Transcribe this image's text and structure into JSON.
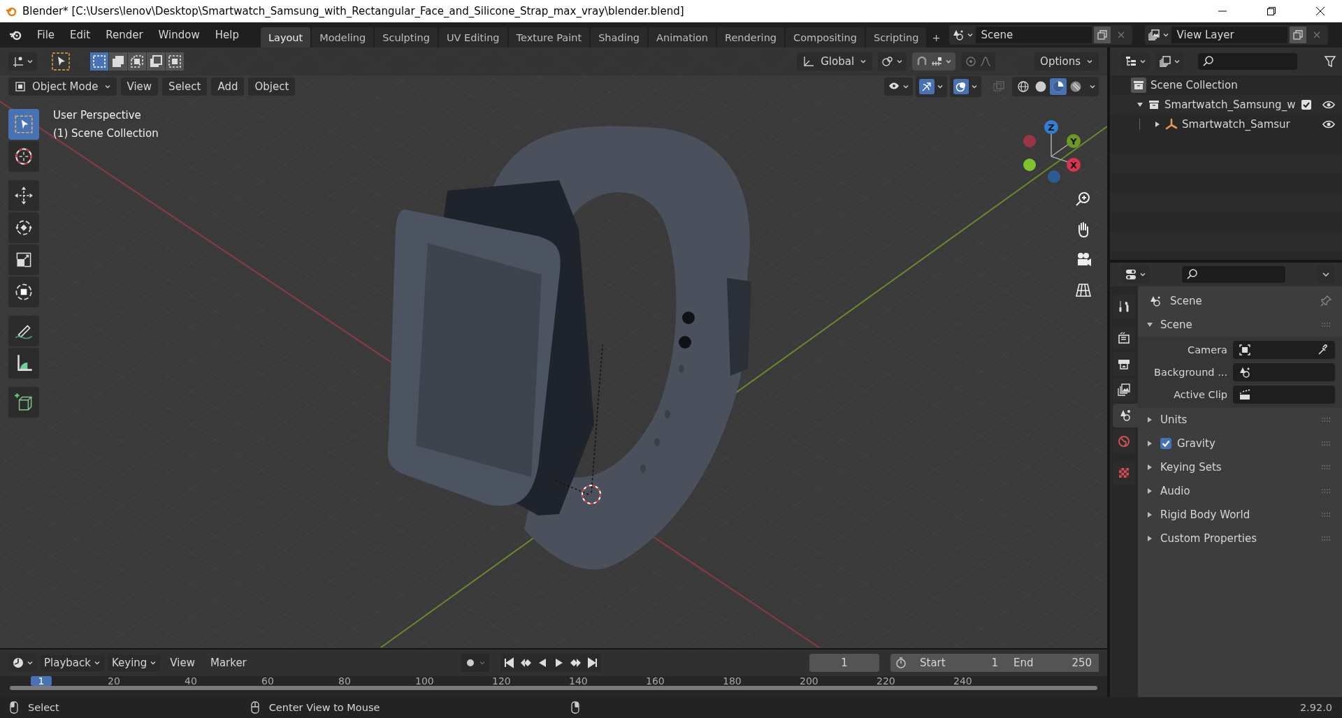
{
  "window": {
    "title": "Blender* [C:\\Users\\lenov\\Desktop\\Smartwatch_Samsung_with_Rectangular_Face_and_Silicone_Strap_max_vray\\blender.blend]"
  },
  "menu": [
    "File",
    "Edit",
    "Render",
    "Window",
    "Help"
  ],
  "workspaces": [
    {
      "label": "Layout",
      "selected": true
    },
    {
      "label": "Modeling",
      "selected": false
    },
    {
      "label": "Sculpting",
      "selected": false
    },
    {
      "label": "UV Editing",
      "selected": false
    },
    {
      "label": "Texture Paint",
      "selected": false
    },
    {
      "label": "Shading",
      "selected": false
    },
    {
      "label": "Animation",
      "selected": false
    },
    {
      "label": "Rendering",
      "selected": false
    },
    {
      "label": "Compositing",
      "selected": false
    },
    {
      "label": "Scripting",
      "selected": false
    }
  ],
  "add_workspace": "+",
  "scene": {
    "name": "Scene"
  },
  "view_layer": {
    "name": "View Layer"
  },
  "tool_header": {
    "orientation": "Global",
    "options": "Options"
  },
  "viewport_header": {
    "mode": "Object Mode",
    "menus": [
      "View",
      "Select",
      "Add",
      "Object"
    ]
  },
  "shading": [
    {
      "kind": "wireframe",
      "selected": false
    },
    {
      "kind": "solid",
      "selected": false
    },
    {
      "kind": "material",
      "selected": true
    },
    {
      "kind": "rendered",
      "selected": false
    }
  ],
  "viewport": {
    "overlay_lines": [
      "User Perspective",
      "(1) Scene Collection"
    ],
    "gizmo_axes": [
      {
        "label": "Z",
        "color": "#2f7fd8"
      },
      {
        "label": "Y",
        "color": "#6b9a23"
      },
      {
        "label": "X",
        "color": "#d8344f"
      }
    ]
  },
  "tools": [
    {
      "kind": "select",
      "selected": true
    },
    {
      "kind": "cursor",
      "selected": false
    },
    {
      "kind": "move",
      "selected": false
    },
    {
      "kind": "rotate",
      "selected": false
    },
    {
      "kind": "scale",
      "selected": false
    },
    {
      "kind": "transform",
      "selected": false
    },
    {
      "kind": "annotate",
      "selected": false
    },
    {
      "kind": "measure",
      "selected": false
    },
    {
      "kind": "add_cube",
      "selected": false
    }
  ],
  "outliner": {
    "root": "Scene Collection",
    "items": [
      {
        "label": "Smartwatch_Samsung_w",
        "expanded": true,
        "checked": true,
        "children": [
          {
            "label": "Smartwatch_Samsur",
            "expanded": false
          }
        ]
      }
    ]
  },
  "properties": {
    "tabs": [
      {
        "kind": "tool",
        "selected": false
      },
      {
        "kind": "render",
        "selected": false
      },
      {
        "kind": "output",
        "selected": false
      },
      {
        "kind": "view_layer",
        "selected": false
      },
      {
        "kind": "scene",
        "selected": true
      },
      {
        "kind": "world",
        "selected": false
      },
      {
        "kind": "texture",
        "selected": false
      }
    ],
    "title": "Scene",
    "panels": [
      {
        "label": "Scene",
        "expanded": true,
        "fields": [
          {
            "label": "Camera",
            "kind": "camera"
          },
          {
            "label": "Background ...",
            "kind": "scene"
          },
          {
            "label": "Active Clip",
            "kind": "clip"
          }
        ]
      },
      {
        "label": "Units",
        "expanded": false
      },
      {
        "label": "Gravity",
        "expanded": false,
        "checked": true
      },
      {
        "label": "Keying Sets",
        "expanded": false
      },
      {
        "label": "Audio",
        "expanded": false
      },
      {
        "label": "Rigid Body World",
        "expanded": false
      },
      {
        "label": "Custom Properties",
        "expanded": false
      }
    ]
  },
  "timeline": {
    "menus": [
      "Playback",
      "Keying",
      "View",
      "Marker"
    ],
    "current_frame": "1",
    "start_label": "Start",
    "start": "1",
    "end_label": "End",
    "end": "250",
    "ruler": [
      {
        "label": "1",
        "selected": true
      },
      {
        "label": "20",
        "selected": false
      },
      {
        "label": "40",
        "selected": false
      },
      {
        "label": "60",
        "selected": false
      },
      {
        "label": "80",
        "selected": false
      },
      {
        "label": "100",
        "selected": false
      },
      {
        "label": "120",
        "selected": false
      },
      {
        "label": "140",
        "selected": false
      },
      {
        "label": "160",
        "selected": false
      },
      {
        "label": "180",
        "selected": false
      },
      {
        "label": "200",
        "selected": false
      },
      {
        "label": "220",
        "selected": false
      },
      {
        "label": "240",
        "selected": false
      }
    ]
  },
  "status_bar": {
    "hints": [
      "Select",
      "Center View to Mouse"
    ],
    "version": "2.92.0"
  }
}
